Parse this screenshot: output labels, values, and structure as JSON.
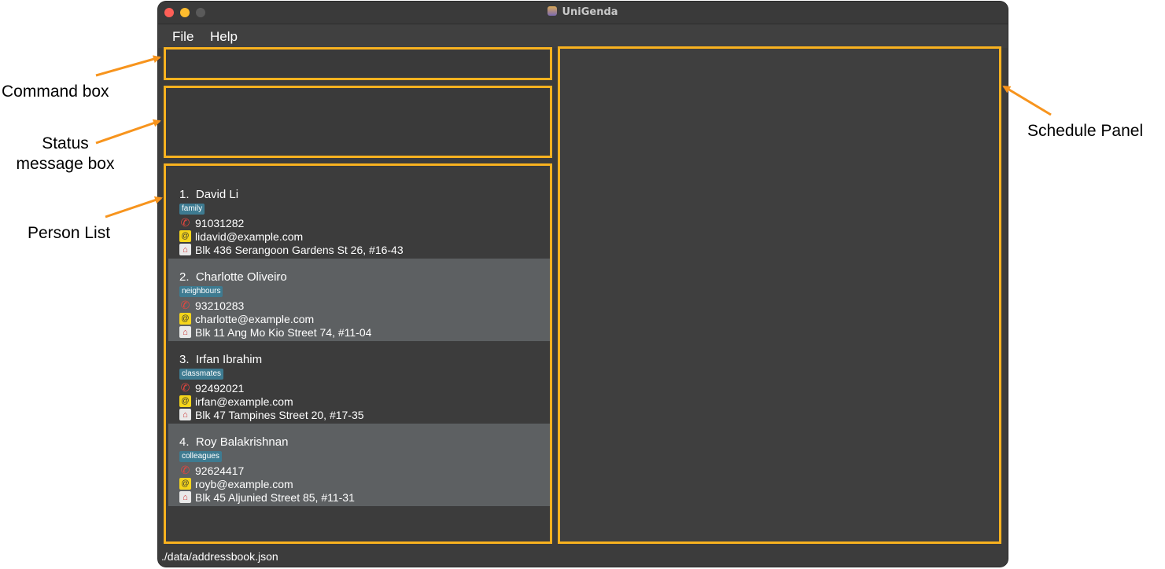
{
  "annotations": {
    "command_box": "Command box",
    "status_line1": "Status",
    "status_line2": "message box",
    "person_list": "Person List",
    "schedule_panel": "Schedule Panel",
    "arrow_color": "#f7941d"
  },
  "window": {
    "title": "UniGenda"
  },
  "menubar": {
    "file": "File",
    "help": "Help"
  },
  "command_box": {
    "value": "",
    "placeholder": ""
  },
  "status_message": "",
  "persons": [
    {
      "index": "1.",
      "name": "David Li",
      "tag": "family",
      "phone": "91031282",
      "email": "lidavid@example.com",
      "address": "Blk 436 Serangoon Gardens St 26, #16-43"
    },
    {
      "index": "2.",
      "name": "Charlotte Oliveiro",
      "tag": "neighbours",
      "phone": "93210283",
      "email": "charlotte@example.com",
      "address": "Blk 11 Ang Mo Kio Street 74, #11-04"
    },
    {
      "index": "3.",
      "name": "Irfan Ibrahim",
      "tag": "classmates",
      "phone": "92492021",
      "email": "irfan@example.com",
      "address": "Blk 47 Tampines Street 20, #17-35"
    },
    {
      "index": "4.",
      "name": "Roy Balakrishnan",
      "tag": "colleagues",
      "phone": "92624417",
      "email": "royb@example.com",
      "address": "Blk 45 Aljunied Street 85, #11-31"
    }
  ],
  "icons": {
    "phone": "phone-icon",
    "email": "email-icon",
    "address": "address-icon"
  },
  "colors": {
    "highlight_border": "#f9b21f",
    "tag_bg": "#3e7b91",
    "window_bg": "#3c3c3c",
    "alt_row_bg": "#5d6062"
  },
  "statusbar": {
    "path": "./data/addressbook.json"
  }
}
